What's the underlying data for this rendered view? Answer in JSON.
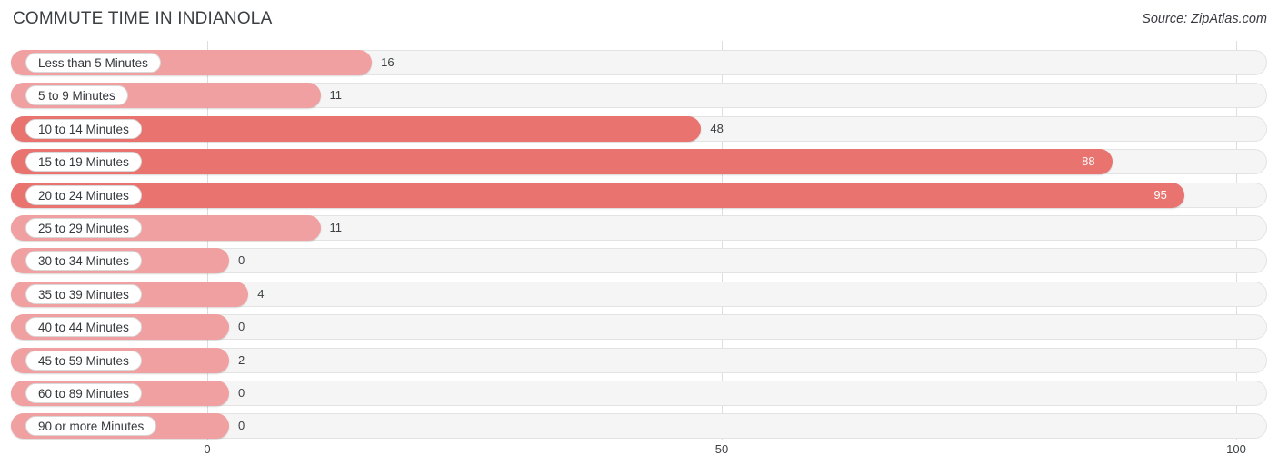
{
  "header": {
    "title": "COMMUTE TIME IN INDIANOLA",
    "source": "Source: ZipAtlas.com"
  },
  "colors": {
    "bar_light": "#F0A0A0",
    "bar_dark": "#E8736F",
    "track_bg": "#F5F5F5",
    "track_border": "#E3E3E3",
    "gridline": "#DDDDDD",
    "text": "#3C4043",
    "value_inside": "#FFFFFF"
  },
  "chart_data": {
    "type": "bar",
    "orientation": "horizontal",
    "title": "COMMUTE TIME IN INDIANOLA",
    "xlabel": "",
    "ylabel": "",
    "xlim": [
      0,
      100
    ],
    "ticks": [
      "0",
      "50",
      "100"
    ],
    "tick_values": [
      0,
      50,
      100
    ],
    "grid": true,
    "legend": false,
    "categories": [
      "Less than 5 Minutes",
      "5 to 9 Minutes",
      "10 to 14 Minutes",
      "15 to 19 Minutes",
      "20 to 24 Minutes",
      "25 to 29 Minutes",
      "30 to 34 Minutes",
      "35 to 39 Minutes",
      "40 to 44 Minutes",
      "45 to 59 Minutes",
      "60 to 89 Minutes",
      "90 or more Minutes"
    ],
    "values": [
      16,
      11,
      48,
      88,
      95,
      11,
      0,
      4,
      0,
      2,
      0,
      0
    ],
    "value_labels": [
      "16",
      "11",
      "48",
      "88",
      "95",
      "11",
      "0",
      "4",
      "0",
      "2",
      "0",
      "0"
    ]
  },
  "rows": [
    {
      "label": "Less than 5 Minutes",
      "value": 16,
      "value_label": "16",
      "inside": false
    },
    {
      "label": "5 to 9 Minutes",
      "value": 11,
      "value_label": "11",
      "inside": false
    },
    {
      "label": "10 to 14 Minutes",
      "value": 48,
      "value_label": "48",
      "inside": false
    },
    {
      "label": "15 to 19 Minutes",
      "value": 88,
      "value_label": "88",
      "inside": true
    },
    {
      "label": "20 to 24 Minutes",
      "value": 95,
      "value_label": "95",
      "inside": true
    },
    {
      "label": "25 to 29 Minutes",
      "value": 11,
      "value_label": "11",
      "inside": false
    },
    {
      "label": "30 to 34 Minutes",
      "value": 0,
      "value_label": "0",
      "inside": false
    },
    {
      "label": "35 to 39 Minutes",
      "value": 4,
      "value_label": "4",
      "inside": false
    },
    {
      "label": "40 to 44 Minutes",
      "value": 0,
      "value_label": "0",
      "inside": false
    },
    {
      "label": "45 to 59 Minutes",
      "value": 2,
      "value_label": "2",
      "inside": false
    },
    {
      "label": "60 to 89 Minutes",
      "value": 0,
      "value_label": "0",
      "inside": false
    },
    {
      "label": "90 or more Minutes",
      "value": 0,
      "value_label": "0",
      "inside": false
    }
  ]
}
